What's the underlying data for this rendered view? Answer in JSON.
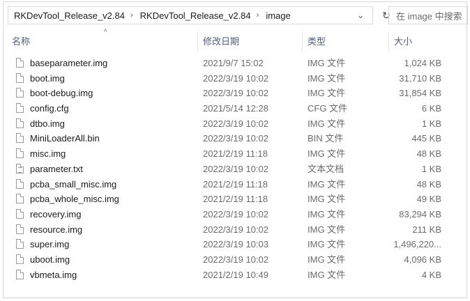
{
  "address": {
    "crumbs": [
      "RKDevTool_Release_v2.84",
      "RKDevTool_Release_v2.84",
      "image"
    ],
    "separator": "›",
    "dropdown_glyph": "⌄",
    "refresh_glyph": "↻"
  },
  "search": {
    "placeholder": "在 image 中搜索"
  },
  "columns": {
    "name": "名称",
    "date": "修改日期",
    "type": "类型",
    "size": "大小",
    "sort_glyph": "^"
  },
  "files": [
    {
      "name": "baseparameter.img",
      "date": "2021/9/7 15:02",
      "type": "IMG 文件",
      "size": "1,024 KB",
      "icon": "file-icon"
    },
    {
      "name": "boot.img",
      "date": "2022/3/19 10:02",
      "type": "IMG 文件",
      "size": "31,710 KB",
      "icon": "file-icon"
    },
    {
      "name": "boot-debug.img",
      "date": "2022/3/19 10:02",
      "type": "IMG 文件",
      "size": "31,854 KB",
      "icon": "file-icon"
    },
    {
      "name": "config.cfg",
      "date": "2021/5/14 12:28",
      "type": "CFG 文件",
      "size": "6 KB",
      "icon": "file-icon"
    },
    {
      "name": "dtbo.img",
      "date": "2022/3/19 10:02",
      "type": "IMG 文件",
      "size": "1 KB",
      "icon": "file-icon"
    },
    {
      "name": "MiniLoaderAll.bin",
      "date": "2022/3/19 10:02",
      "type": "BIN 文件",
      "size": "445 KB",
      "icon": "file-icon"
    },
    {
      "name": "misc.img",
      "date": "2021/2/19 11:18",
      "type": "IMG 文件",
      "size": "48 KB",
      "icon": "file-icon"
    },
    {
      "name": "parameter.txt",
      "date": "2022/3/19 10:02",
      "type": "文本文档",
      "size": "1 KB",
      "icon": "text-file-icon"
    },
    {
      "name": "pcba_small_misc.img",
      "date": "2021/2/19 11:18",
      "type": "IMG 文件",
      "size": "48 KB",
      "icon": "file-icon"
    },
    {
      "name": "pcba_whole_misc.img",
      "date": "2021/2/19 11:18",
      "type": "IMG 文件",
      "size": "49 KB",
      "icon": "file-icon"
    },
    {
      "name": "recovery.img",
      "date": "2022/3/19 10:02",
      "type": "IMG 文件",
      "size": "83,294 KB",
      "icon": "file-icon"
    },
    {
      "name": "resource.img",
      "date": "2022/3/19 10:02",
      "type": "IMG 文件",
      "size": "211 KB",
      "icon": "file-icon"
    },
    {
      "name": "super.img",
      "date": "2022/3/19 10:03",
      "type": "IMG 文件",
      "size": "1,496,220...",
      "icon": "file-icon"
    },
    {
      "name": "uboot.img",
      "date": "2022/3/19 10:02",
      "type": "IMG 文件",
      "size": "4,096 KB",
      "icon": "file-icon"
    },
    {
      "name": "vbmeta.img",
      "date": "2021/2/19 10:49",
      "type": "IMG 文件",
      "size": "4 KB",
      "icon": "file-icon"
    }
  ],
  "colors": {
    "header_text": "#4c5d7d",
    "secondary_text": "#6b6b6b",
    "border": "#d9d9d9"
  }
}
